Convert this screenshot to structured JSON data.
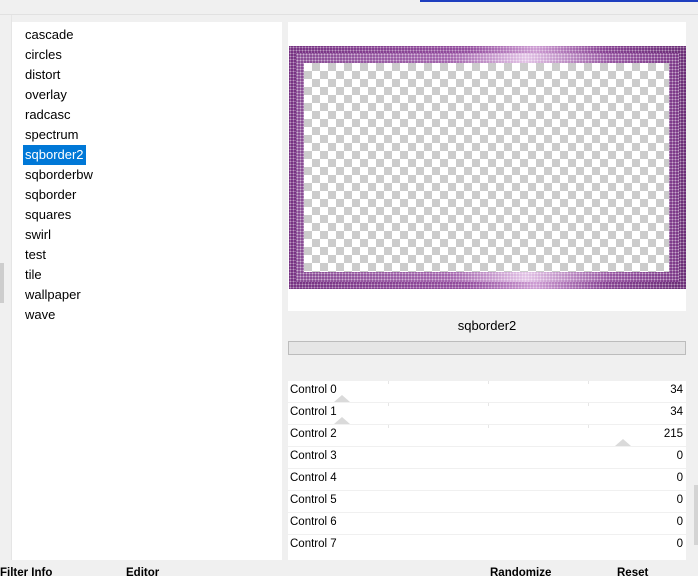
{
  "filters": {
    "items": [
      "cascade",
      "circles",
      "distort",
      "overlay",
      "radcasc",
      "spectrum",
      "sqborder2",
      "sqborderbw",
      "sqborder",
      "squares",
      "swirl",
      "test",
      "tile",
      "wallpaper",
      "wave"
    ],
    "selected_index": 6
  },
  "preview": {
    "name": "sqborder2",
    "progress": 0
  },
  "controls": [
    {
      "label": "Control 0",
      "value": "34"
    },
    {
      "label": "Control 1",
      "value": "34"
    },
    {
      "label": "Control 2",
      "value": "215"
    },
    {
      "label": "Control 3",
      "value": "0"
    },
    {
      "label": "Control 4",
      "value": "0"
    },
    {
      "label": "Control 5",
      "value": "0"
    },
    {
      "label": "Control 6",
      "value": "0"
    },
    {
      "label": "Control 7",
      "value": "0"
    }
  ],
  "tabs": {
    "filter_info": "Filter Info",
    "editor": "Editor"
  },
  "buttons": {
    "randomize": "Randomize",
    "reset": "Reset"
  },
  "colors": {
    "selection": "#0078d7",
    "border_dark": "#5e1c6b",
    "border_light": "#c994cf",
    "progress": "#06b025"
  }
}
